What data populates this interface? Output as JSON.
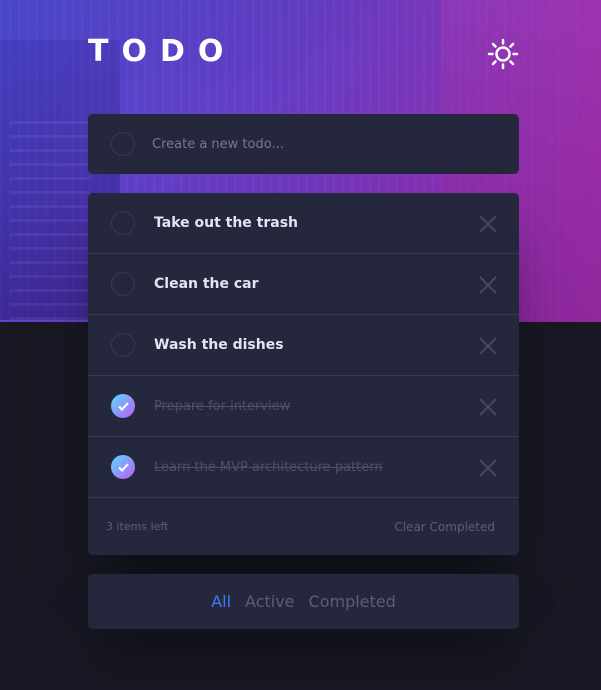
{
  "app": {
    "title": "TODO"
  },
  "icons": {
    "theme": "sun-icon",
    "check": "check-icon",
    "delete": "cross-icon"
  },
  "colors": {
    "accent": "#3a7cfd",
    "check_gradient_start": "#55ddff",
    "check_gradient_end": "#c058f3"
  },
  "new_todo": {
    "placeholder": "Create a new todo..."
  },
  "todos": [
    {
      "label": "Take out the trash",
      "completed": false
    },
    {
      "label": "Clean the car",
      "completed": false
    },
    {
      "label": "Wash the dishes",
      "completed": false
    },
    {
      "label": "Prepare for interview",
      "completed": true
    },
    {
      "label": "Learn the MVP architecture pattern",
      "completed": true
    }
  ],
  "footer": {
    "items_left": "3 items left",
    "clear_label": "Clear Completed"
  },
  "filters": {
    "all": "All",
    "active": "Active",
    "completed": "Completed",
    "selected": "All"
  }
}
